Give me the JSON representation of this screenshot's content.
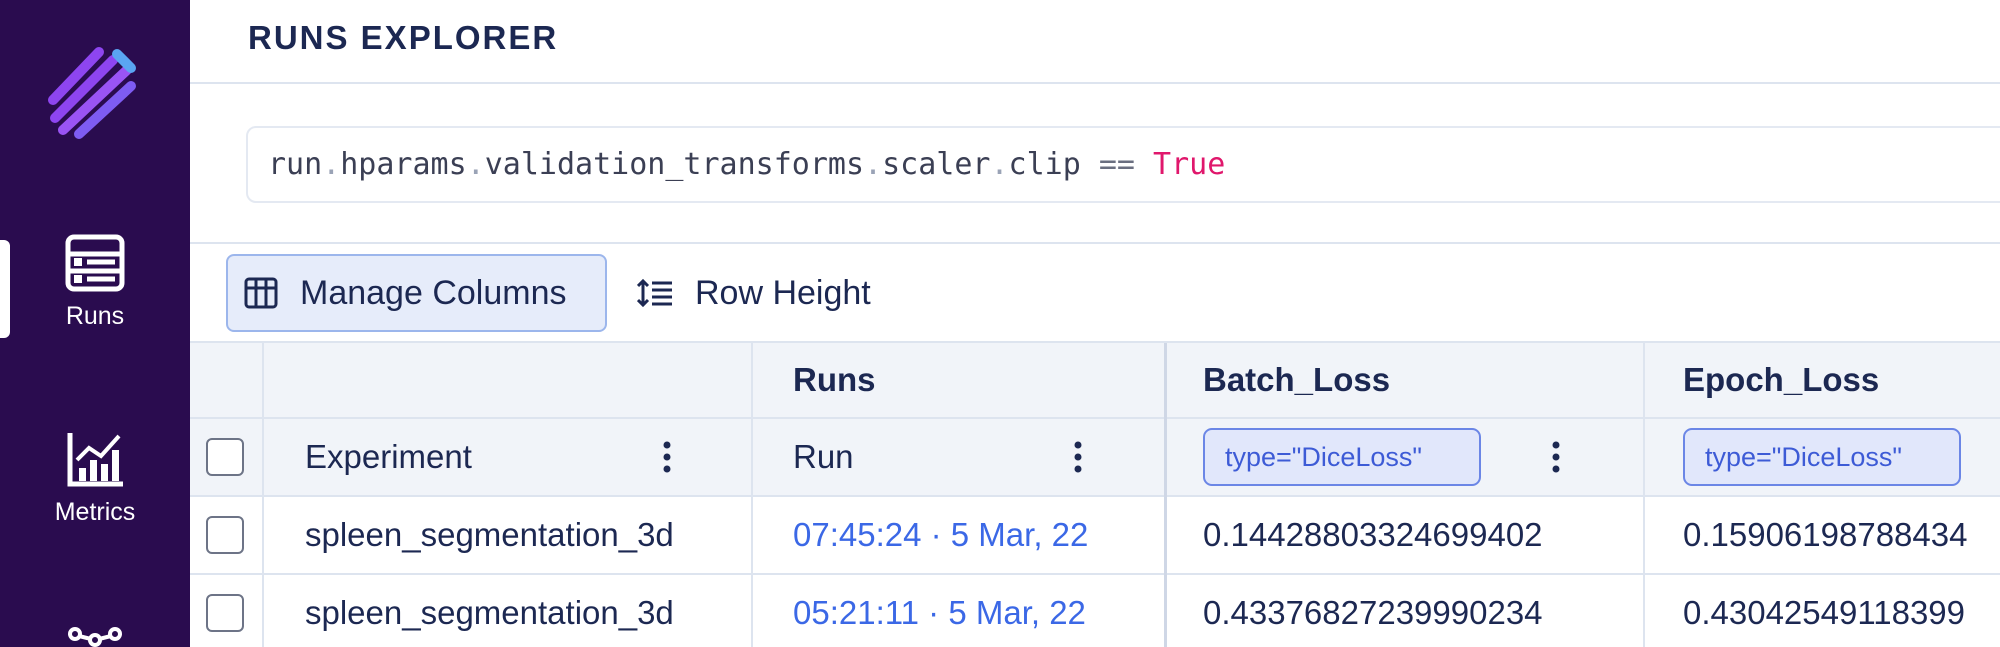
{
  "sidebar": {
    "nav": [
      {
        "label": "Runs",
        "icon": "table-list-icon",
        "active": true
      },
      {
        "label": "Metrics",
        "icon": "bar-chart-icon",
        "active": false
      },
      {
        "label": "",
        "icon": "network-icon",
        "active": false
      }
    ],
    "logo": "aim-logo",
    "colors": {
      "background": "#2a0c4f",
      "logo_primary": "#8e45f0",
      "logo_accent": "#5aa5f2"
    }
  },
  "header": {
    "title": "RUNS EXPLORER"
  },
  "query": {
    "parts": [
      "run",
      ".",
      "hparams",
      ".",
      "validation_transforms",
      ".",
      "scaler",
      ".",
      "clip",
      " == ",
      "True"
    ]
  },
  "toolbar": {
    "manage_columns_label": "Manage Columns",
    "row_height_label": "Row Height"
  },
  "table": {
    "group_headers": [
      "Runs",
      "Batch_Loss",
      "Epoch_Loss"
    ],
    "columns": [
      "Experiment",
      "Run"
    ],
    "metric_tags": [
      "type=\"DiceLoss\"",
      "type=\"DiceLoss\""
    ],
    "rows": [
      {
        "experiment": "spleen_segmentation_3d",
        "run": "07:45:24 · 5 Mar, 22",
        "batch_loss": "0.14428803324699402",
        "epoch_loss": "0.15906198788434"
      },
      {
        "experiment": "spleen_segmentation_3d",
        "run": "05:21:11 · 5 Mar, 22",
        "batch_loss": "0.43376827239990234",
        "epoch_loss": "0.43042549118399"
      }
    ],
    "colors": {
      "header_bg": "#f1f4f9",
      "link": "#3b68e6",
      "tag_bg": "#e1e7fb",
      "tag_border": "#6b86e6"
    }
  }
}
